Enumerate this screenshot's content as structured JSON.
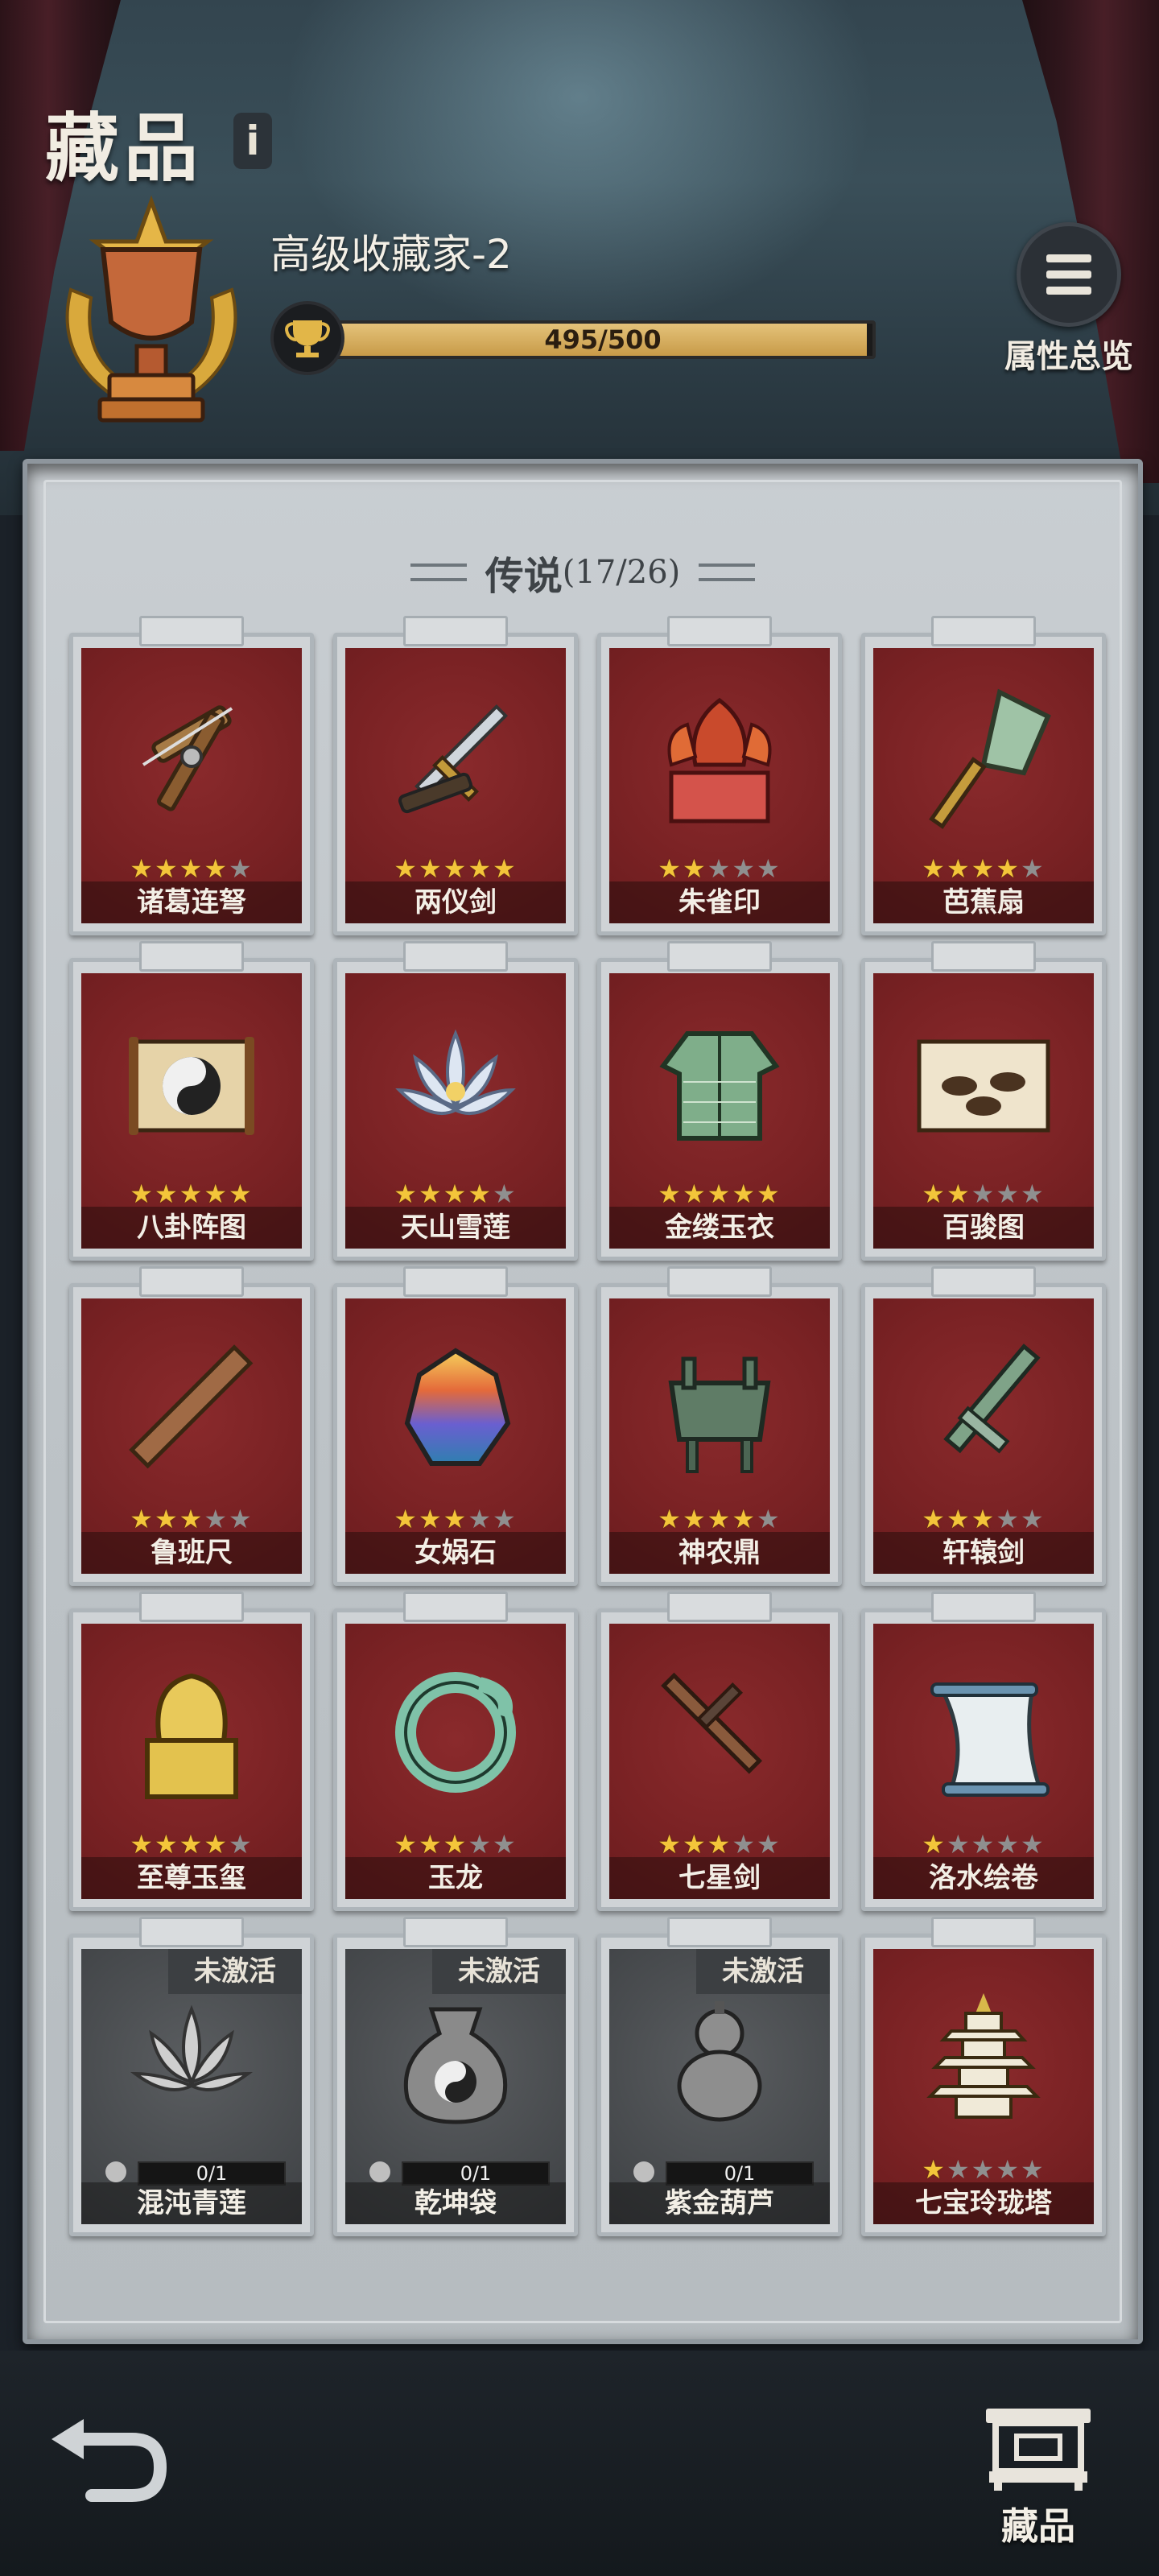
{
  "header": {
    "title": "藏品",
    "info_glyph": "i",
    "rank_title": "高级收藏家-2",
    "xp_text": "495/500",
    "xp_progress": 0.99,
    "attr_overview_label": "属性总览"
  },
  "section": {
    "title": "传说",
    "count": "(17/26)"
  },
  "items": [
    {
      "name": "诸葛连弩",
      "stars": 4,
      "active": true,
      "icon": "crossbow-icon"
    },
    {
      "name": "两仪剑",
      "stars": 5,
      "active": true,
      "icon": "sword-icon"
    },
    {
      "name": "朱雀印",
      "stars": 2,
      "active": true,
      "icon": "phoenix-seal-icon"
    },
    {
      "name": "芭蕉扇",
      "stars": 4,
      "active": true,
      "icon": "fan-icon"
    },
    {
      "name": "八卦阵图",
      "stars": 5,
      "active": true,
      "icon": "bagua-scroll-icon"
    },
    {
      "name": "天山雪莲",
      "stars": 4,
      "active": true,
      "icon": "lotus-icon"
    },
    {
      "name": "金缕玉衣",
      "stars": 5,
      "active": true,
      "icon": "jade-armor-icon"
    },
    {
      "name": "百骏图",
      "stars": 2,
      "active": true,
      "icon": "horse-painting-icon"
    },
    {
      "name": "鲁班尺",
      "stars": 3,
      "active": true,
      "icon": "ruler-icon"
    },
    {
      "name": "女娲石",
      "stars": 3,
      "active": true,
      "icon": "rainbow-stone-icon"
    },
    {
      "name": "神农鼎",
      "stars": 4,
      "active": true,
      "icon": "cauldron-icon"
    },
    {
      "name": "轩辕剑",
      "stars": 3,
      "active": true,
      "icon": "bronze-sword-icon"
    },
    {
      "name": "至尊玉玺",
      "stars": 4,
      "active": true,
      "icon": "imperial-seal-icon"
    },
    {
      "name": "玉龙",
      "stars": 3,
      "active": true,
      "icon": "jade-dragon-icon"
    },
    {
      "name": "七星剑",
      "stars": 3,
      "active": true,
      "icon": "seven-star-sword-icon"
    },
    {
      "name": "洛水绘卷",
      "stars": 1,
      "active": true,
      "icon": "scroll-icon"
    },
    {
      "name": "混沌青莲",
      "active": false,
      "tag": "未激活",
      "progress": "0/1",
      "icon": "chaos-lotus-icon"
    },
    {
      "name": "乾坤袋",
      "active": false,
      "tag": "未激活",
      "progress": "0/1",
      "icon": "bagua-pouch-icon"
    },
    {
      "name": "紫金葫芦",
      "active": false,
      "tag": "未激活",
      "progress": "0/1",
      "icon": "gourd-icon"
    },
    {
      "name": "七宝玲珑塔",
      "stars": 1,
      "active": true,
      "icon": "pagoda-icon"
    }
  ],
  "footer": {
    "collection_label": "藏品"
  },
  "colors": {
    "card_red": "#7a2224",
    "card_gray": "#4a4d50",
    "star_gold": "#f3c53a",
    "xp_gold": "#d9b064"
  }
}
